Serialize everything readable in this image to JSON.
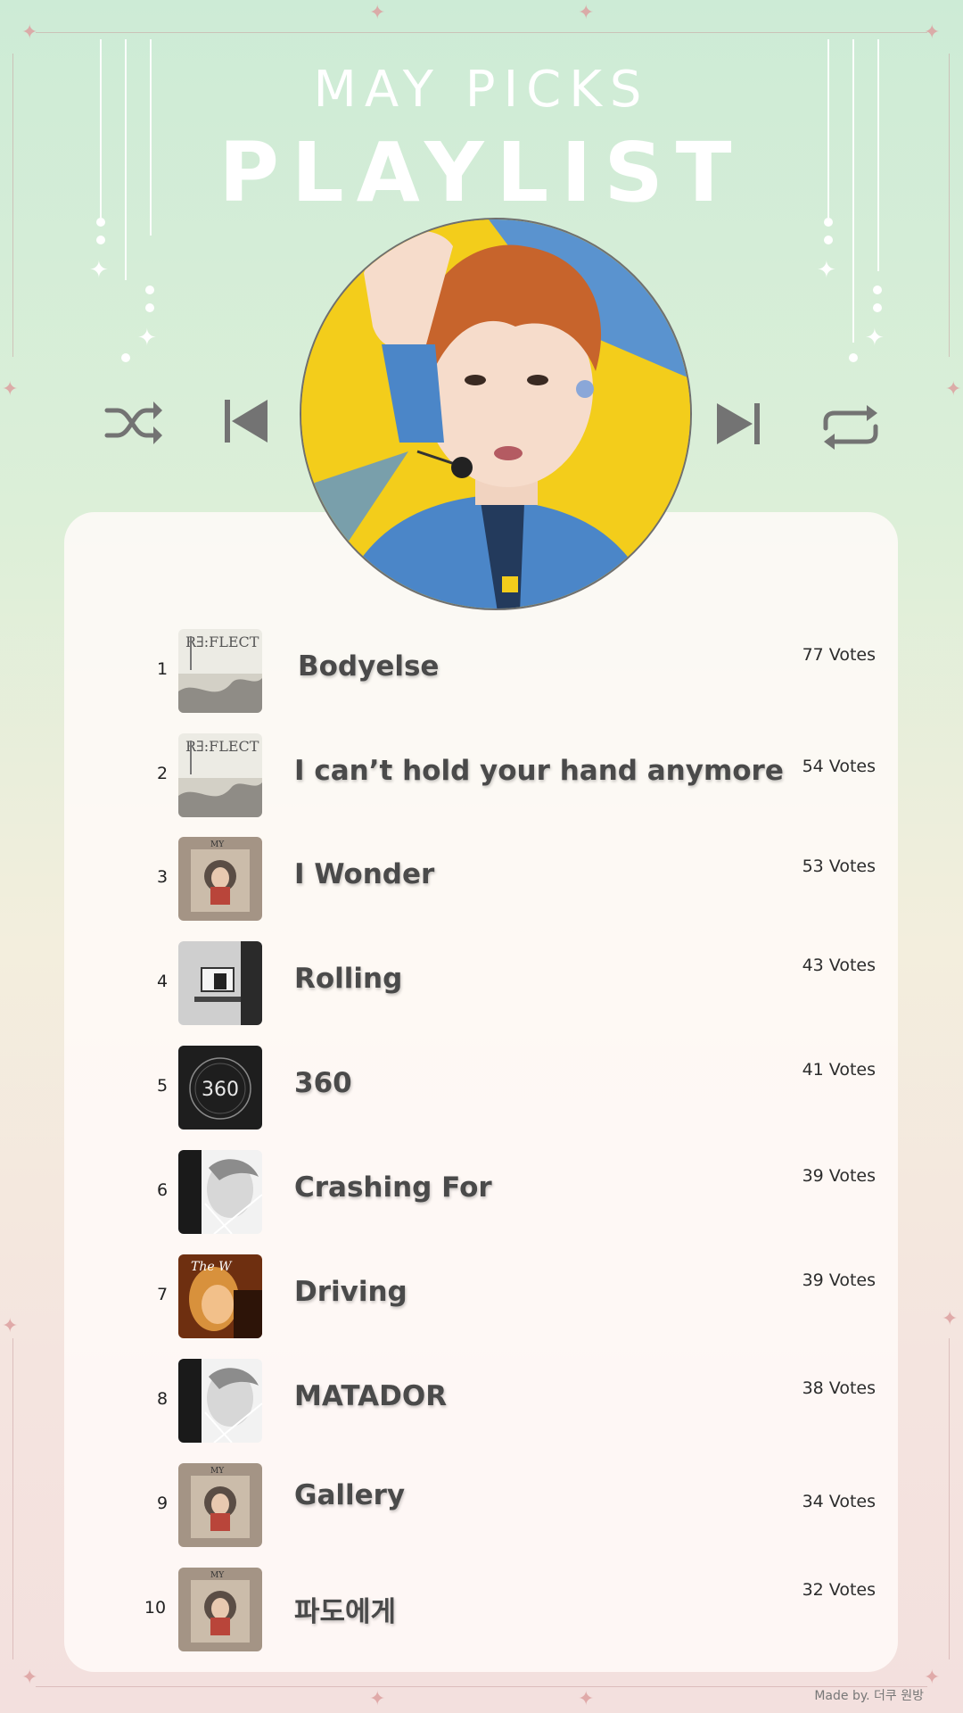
{
  "header": {
    "subtitle": "MAY PICKS",
    "title": "PLAYLIST"
  },
  "player": {
    "controls": [
      "shuffle-icon",
      "previous-icon",
      "next-icon",
      "repeat-icon"
    ],
    "control_color": "#737373"
  },
  "tracks": [
    {
      "rank": "1",
      "title": "Bodyelse",
      "votes": "77 Votes",
      "album_art": "reflect"
    },
    {
      "rank": "2",
      "title": "I can’t hold your hand anymore",
      "votes": "54 Votes",
      "album_art": "reflect"
    },
    {
      "rank": "3",
      "title": "I Wonder",
      "votes": "53 Votes",
      "album_art": "my-collection"
    },
    {
      "rank": "4",
      "title": "Rolling",
      "votes": "43 Votes",
      "album_art": "message"
    },
    {
      "rank": "5",
      "title": "360",
      "votes": "41 Votes",
      "album_art": "360",
      "art_text": "360"
    },
    {
      "rank": "6",
      "title": "Crashing For",
      "votes": "39 Votes",
      "album_art": "portrait-bw"
    },
    {
      "rank": "7",
      "title": "Driving",
      "votes": "39 Votes",
      "album_art": "the-w"
    },
    {
      "rank": "8",
      "title": "MATADOR",
      "votes": "38 Votes",
      "album_art": "portrait-bw"
    },
    {
      "rank": "9",
      "title": "Gallery",
      "votes": "34 Votes",
      "album_art": "my-collection"
    },
    {
      "rank": "10",
      "title": "파도에게",
      "votes": "32 Votes",
      "album_art": "my-collection"
    }
  ],
  "credit": "Made by. 더쿠 원방",
  "colors": {
    "accent_gold": "#f3cd1b",
    "denim": "#4b86c8",
    "hair": "#c7642c"
  }
}
